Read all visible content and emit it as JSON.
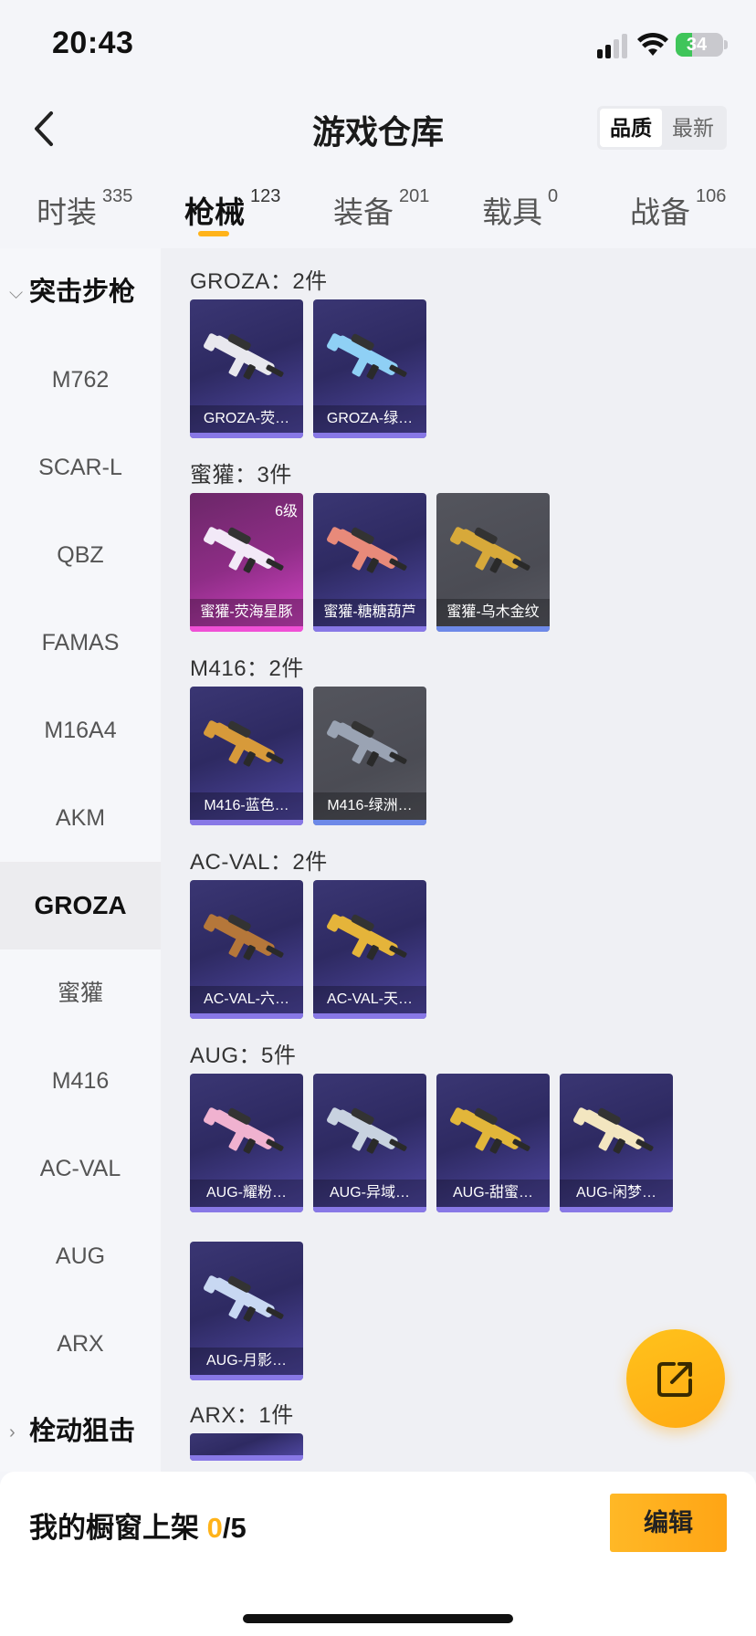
{
  "status_bar": {
    "time": "20:43",
    "battery": "34",
    "battery_level": 0.34
  },
  "header": {
    "title": "游戏仓库",
    "sort_options": [
      "品质",
      "最新"
    ],
    "sort_selected": "品质"
  },
  "tabs": [
    {
      "label": "时装",
      "count": "335"
    },
    {
      "label": "枪械",
      "count": "123",
      "active": true
    },
    {
      "label": "装备",
      "count": "201"
    },
    {
      "label": "载具",
      "count": "0"
    },
    {
      "label": "战备",
      "count": "106"
    }
  ],
  "sidebar": {
    "group_assault": "突击步枪",
    "items": [
      "M762",
      "SCAR-L",
      "QBZ",
      "FAMAS",
      "M16A4",
      "AKM",
      "GROZA",
      "蜜獾",
      "M416",
      "AC-VAL",
      "AUG",
      "ARX"
    ],
    "active_item": "GROZA",
    "group_bolt": "栓动狙击"
  },
  "sections": [
    {
      "title": "GROZA：2件",
      "items": [
        {
          "label": "GROZA-荧…",
          "tier": "purple"
        },
        {
          "label": "GROZA-绿…",
          "tier": "purple"
        }
      ]
    },
    {
      "title": "蜜獾：3件",
      "items": [
        {
          "label": "蜜獾-荧海星豚",
          "tier": "pink",
          "level": "6级"
        },
        {
          "label": "蜜獾-糖糖葫芦",
          "tier": "purple"
        },
        {
          "label": "蜜獾-乌木金纹",
          "tier": "gray"
        }
      ]
    },
    {
      "title": "M416：2件",
      "items": [
        {
          "label": "M416-蓝色…",
          "tier": "purple"
        },
        {
          "label": "M416-绿洲…",
          "tier": "gray"
        }
      ]
    },
    {
      "title": "AC-VAL：2件",
      "items": [
        {
          "label": "AC-VAL-六…",
          "tier": "purple"
        },
        {
          "label": "AC-VAL-天…",
          "tier": "purple"
        }
      ]
    },
    {
      "title": "AUG：5件",
      "items": [
        {
          "label": "AUG-耀粉…",
          "tier": "purple"
        },
        {
          "label": "AUG-异域…",
          "tier": "purple"
        },
        {
          "label": "AUG-甜蜜…",
          "tier": "purple"
        },
        {
          "label": "AUG-闲梦…",
          "tier": "purple"
        },
        {
          "label": "AUG-月影…",
          "tier": "purple"
        }
      ]
    },
    {
      "title": "ARX：1件",
      "items": [
        {
          "label": "",
          "tier": "purple"
        }
      ]
    }
  ],
  "bottom": {
    "title": "我的橱窗上架",
    "current": "0",
    "max": "/5",
    "edit_label": "编辑"
  },
  "colors": {
    "accent": "#ffb31a",
    "card_purple": "#3a3673",
    "card_pink": "#8e2d86",
    "card_gray": "#54555d"
  },
  "icons": {
    "back": "chevron-left-icon",
    "share": "share-external-icon"
  }
}
